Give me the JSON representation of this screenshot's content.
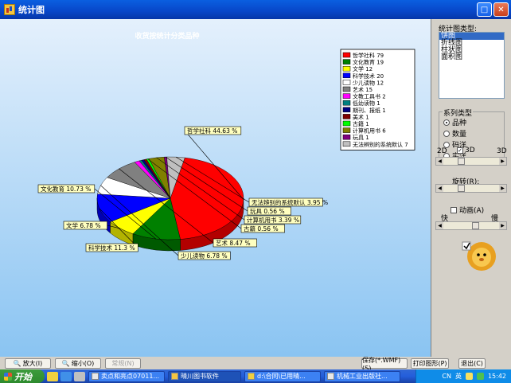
{
  "window": {
    "title": "统计图"
  },
  "side": {
    "chart_type_label": "统计图类型:",
    "chart_types": [
      "饼图",
      "折线图",
      "柱状图",
      "面积图"
    ],
    "selected_chart_type": "饼图",
    "series_label": "系列类型",
    "series_options": [
      "品种",
      "数量",
      "码洋",
      "实洋"
    ],
    "selected_series": "品种",
    "label_2d": "2D",
    "label_3d_check": "3D",
    "label_3d": "3D",
    "rotate_label": "旋转(R):",
    "animate_label": "动画(A)",
    "fast_label": "快",
    "slow_label": "慢"
  },
  "toolbar": {
    "zoom_in": "放大(I)",
    "zoom_out": "缩小(O)",
    "normal": "常规(N)",
    "save": "保存(*.WMF)(S)",
    "print": "打印图形(P)",
    "exit": "退出(C)"
  },
  "taskbar": {
    "start": "开始",
    "tasks": [
      "卖点和亮点07011...",
      "晴川图书软件",
      "d:\\合同\\已用晴...",
      "机械工业出版社..."
    ],
    "ime": "英",
    "lang": "CN",
    "clock": "15:42"
  },
  "chart_data": {
    "type": "pie",
    "title": "收货按统计分类品种",
    "style": "3d",
    "legend_position": "top-right",
    "series": [
      {
        "name": "哲学社科",
        "value": 79,
        "percent": 44.63,
        "label": "哲学社科 44.63 %",
        "color": "#ff0000"
      },
      {
        "name": "文化教育",
        "value": 19,
        "percent": 10.73,
        "label": "文化教育 10.73 %",
        "color": "#008000"
      },
      {
        "name": "文学",
        "value": 12,
        "percent": 6.78,
        "label": "文学 6.78 %",
        "color": "#ffff00"
      },
      {
        "name": "科学技术",
        "value": 20,
        "percent": 11.3,
        "label": "科学技术 11.3 %",
        "color": "#0000ff"
      },
      {
        "name": "少儿读物",
        "value": 12,
        "percent": 6.78,
        "label": "少儿读物 6.78 %",
        "color": "#ffffff"
      },
      {
        "name": "艺术",
        "value": 15,
        "percent": 8.47,
        "label": "艺术 8.47 %",
        "color": "#808080"
      },
      {
        "name": "文教工具书",
        "value": 2,
        "percent": 1.13,
        "label": "",
        "color": "#ff00ff"
      },
      {
        "name": "低幼读物",
        "value": 1,
        "percent": 0.56,
        "label": "",
        "color": "#008080"
      },
      {
        "name": "期刊、报纸",
        "value": 1,
        "percent": 0.56,
        "label": "",
        "color": "#000080"
      },
      {
        "name": "美术",
        "value": 1,
        "percent": 0.56,
        "label": "",
        "color": "#800000"
      },
      {
        "name": "古籍",
        "value": 1,
        "percent": 0.56,
        "label": "古籍 0.56 %",
        "color": "#00ff00"
      },
      {
        "name": "计算机用书",
        "value": 6,
        "percent": 3.39,
        "label": "计算机用书 3.39 %",
        "color": "#808000"
      },
      {
        "name": "玩具",
        "value": 1,
        "percent": 0.56,
        "label": "玩具 0.56 %",
        "color": "#800080"
      },
      {
        "name": "无法辨别的系统默认",
        "value": 7,
        "percent": 3.95,
        "label": "无法辨别的系统默认 3.95 %",
        "color": "#c0c0c0"
      }
    ]
  }
}
